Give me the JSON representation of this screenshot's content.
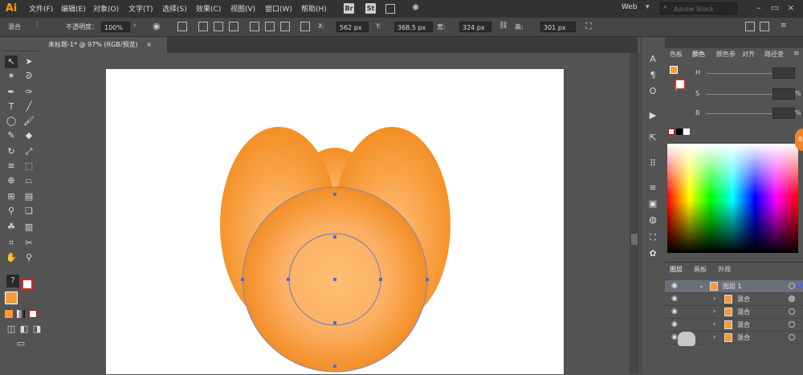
{
  "app": {
    "logo": "Ai"
  },
  "menu": [
    "文件(F)",
    "编辑(E)",
    "对象(O)",
    "文字(T)",
    "选择(S)",
    "效果(C)",
    "视图(V)",
    "窗口(W)",
    "帮助(H)"
  ],
  "menubar_buttons": [
    "Br",
    "St"
  ],
  "workspace": "Web",
  "search": {
    "placeholder": "Adobe Stock"
  },
  "control": {
    "mode": "混合",
    "opacity_label": "不透明度：",
    "opacity_value": "100%",
    "x_label": "X:",
    "x_value": "562 px",
    "y_label": "Y:",
    "y_value": "368.5 px",
    "w_label": "宽:",
    "w_value": "324 px",
    "h_label": "高:",
    "h_value": "301 px"
  },
  "document_tab": {
    "title": "未标题-1* @ 97% (RGB/预览)",
    "close": "×"
  },
  "color_panel": {
    "tabs": [
      "色板",
      "颜色",
      "颜色参",
      "对齐",
      "路径查"
    ],
    "active_tab": "颜色",
    "channels": [
      {
        "label": "H",
        "unit": ""
      },
      {
        "label": "S",
        "unit": "%"
      },
      {
        "label": "B",
        "unit": "%"
      }
    ]
  },
  "layers_panel": {
    "tabs": [
      "图层",
      "画板",
      "外观"
    ],
    "active_tab": "图层",
    "rows": [
      {
        "name": "图层 1",
        "selected": true,
        "expanded": true
      },
      {
        "name": "混合",
        "selected": false
      },
      {
        "name": "混合",
        "selected": false
      },
      {
        "name": "混合",
        "selected": false
      },
      {
        "name": "混合",
        "selected": false
      }
    ]
  },
  "colors": {
    "accent_orange": "#f59a3a",
    "canvas": "#535353",
    "artboard": "#ffffff",
    "selection_blue": "#4e6bd6"
  },
  "icons": [
    "search-icon",
    "selection-tool-icon",
    "direct-selection-icon",
    "magic-wand-icon",
    "lasso-icon",
    "pen-icon",
    "type-icon",
    "line-icon",
    "ellipse-icon",
    "brush-icon",
    "pencil-icon",
    "eraser-icon",
    "rotate-icon",
    "scale-icon",
    "width-icon",
    "free-transform-icon",
    "shape-builder-icon",
    "perspective-icon",
    "mesh-icon",
    "gradient-icon",
    "eyedropper-icon",
    "blend-icon",
    "symbol-icon",
    "graph-icon",
    "artboard-icon",
    "slice-icon",
    "hand-icon",
    "zoom-icon",
    "eye-icon",
    "chevron-icon"
  ]
}
